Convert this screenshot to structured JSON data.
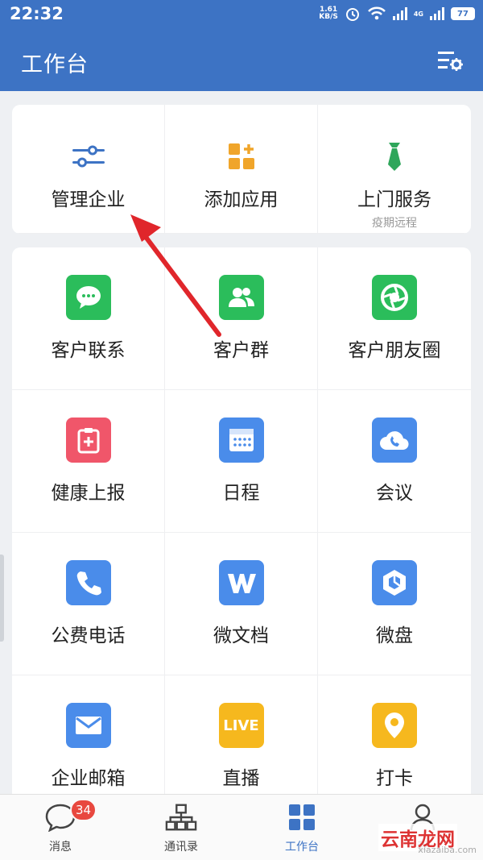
{
  "status_bar": {
    "time": "22:32",
    "speed_value": "1.61",
    "speed_unit": "KB/S",
    "network_type": "4G",
    "battery": "77"
  },
  "header": {
    "title": "工作台",
    "settings_icon": "settings-list-icon"
  },
  "top_apps": [
    {
      "label": "管理企业",
      "sub": "",
      "icon": "sliders-icon",
      "color": "#3d73c4"
    },
    {
      "label": "添加应用",
      "sub": "",
      "icon": "add-app-icon",
      "color": "#f0a52a"
    },
    {
      "label": "上门服务",
      "sub": "疫期远程",
      "icon": "tie-icon",
      "color": "#2fa65b"
    }
  ],
  "apps": [
    {
      "label": "客户联系",
      "icon": "chat-bubble-icon",
      "color": "#2bbd5b"
    },
    {
      "label": "客户群",
      "icon": "group-users-icon",
      "color": "#2bbd5b"
    },
    {
      "label": "客户朋友圈",
      "icon": "aperture-icon",
      "color": "#2bbd5b"
    },
    {
      "label": "健康上报",
      "icon": "clipboard-plus-icon",
      "color": "#f0566a"
    },
    {
      "label": "日程",
      "icon": "calendar-icon",
      "color": "#4a8cea"
    },
    {
      "label": "会议",
      "icon": "cloud-phone-icon",
      "color": "#4a8cea"
    },
    {
      "label": "公费电话",
      "icon": "phone-icon",
      "color": "#4a8cea"
    },
    {
      "label": "微文档",
      "icon": "doc-w-icon",
      "color": "#4a8cea"
    },
    {
      "label": "微盘",
      "icon": "drive-cube-icon",
      "color": "#4a8cea"
    },
    {
      "label": "企业邮箱",
      "icon": "mail-icon",
      "color": "#4a8cea"
    },
    {
      "label": "直播",
      "icon": "live-icon",
      "color": "#f6b81e",
      "icon_text": "LIVE"
    },
    {
      "label": "打卡",
      "icon": "location-pin-icon",
      "color": "#f6b81e"
    }
  ],
  "bottom_nav": [
    {
      "label": "消息",
      "icon": "message-icon",
      "badge": "34"
    },
    {
      "label": "通讯录",
      "icon": "org-chart-icon"
    },
    {
      "label": "工作台",
      "icon": "workbench-grid-icon",
      "active": true
    },
    {
      "label": "我",
      "icon": "person-icon"
    }
  ],
  "watermark": {
    "text": "云南龙网",
    "sub": "xiazaiba.com"
  },
  "colors": {
    "header": "#3d73c4",
    "accent": "#3d73c4",
    "badge": "#e8483f",
    "arrow": "#e0262b"
  }
}
